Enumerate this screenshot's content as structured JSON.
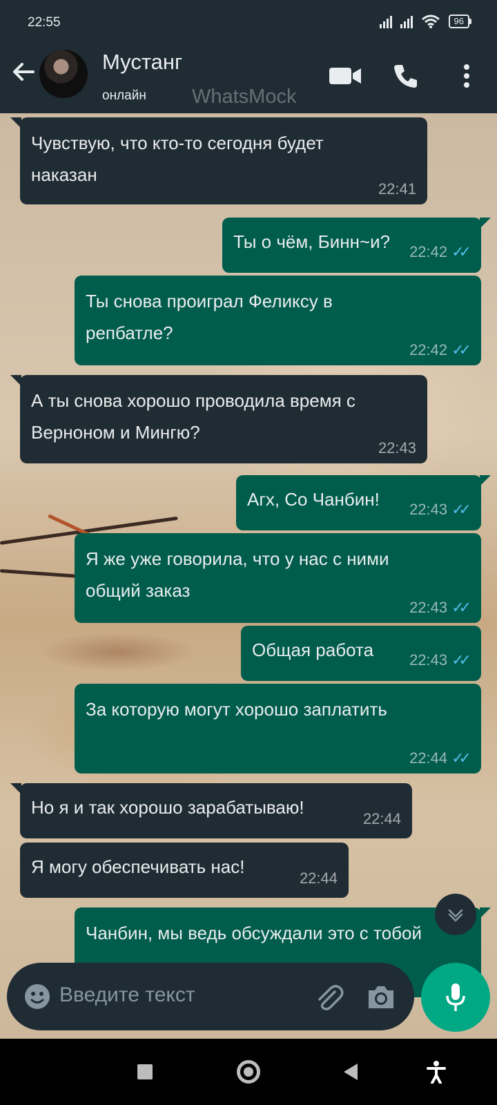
{
  "status_bar": {
    "time": "22:55",
    "battery": "96"
  },
  "header": {
    "contact_name": "Мустанг",
    "status": "онлайн",
    "watermark": "WhatsMock"
  },
  "messages": [
    {
      "direction": "in",
      "lines": [
        "Чувствую, что кто-то сегодня будет",
        "наказан"
      ],
      "time": "22:41"
    },
    {
      "direction": "out",
      "lines": [
        "Ты о чём, Бинн~и?"
      ],
      "time": "22:42",
      "read": true
    },
    {
      "direction": "out",
      "lines": [
        "Ты снова проиграл Феликсу в",
        "репбатле?"
      ],
      "time": "22:42",
      "read": true
    },
    {
      "direction": "in",
      "lines": [
        "А ты снова хорошо проводила время с",
        "Верноном и Мингю?"
      ],
      "time": "22:43"
    },
    {
      "direction": "out",
      "lines": [
        "Агх, Со Чанбин!"
      ],
      "time": "22:43",
      "read": true
    },
    {
      "direction": "out",
      "lines": [
        "Я же уже говорила, что у нас с ними",
        "общий заказ"
      ],
      "time": "22:43",
      "read": true
    },
    {
      "direction": "out",
      "lines": [
        "Общая работа"
      ],
      "time": "22:43",
      "read": true
    },
    {
      "direction": "out",
      "lines": [
        "За которую могут хорошо заплатить"
      ],
      "time": "22:44",
      "read": true
    },
    {
      "direction": "in",
      "lines": [
        "Но я и так хорошо зарабатываю!"
      ],
      "time": "22:44"
    },
    {
      "direction": "in",
      "lines": [
        "Я могу обеспечивать нас!"
      ],
      "time": "22:44"
    },
    {
      "direction": "out",
      "lines": [
        "Чанбин, мы ведь обсуждали это с тобой"
      ],
      "time": "",
      "read": true
    }
  ],
  "composer": {
    "placeholder": "Введите текст"
  },
  "colors": {
    "header_bg": "#1f2c34",
    "incoming_bubble": "#202c33",
    "outgoing_bubble": "#005c4b",
    "accent": "#00a884",
    "read_tick": "#53bdeb"
  },
  "icons": {
    "back": "arrow-left-icon",
    "video": "video-camera-icon",
    "call": "phone-icon",
    "menu": "more-vertical-icon",
    "emoji": "emoji-icon",
    "attach": "paperclip-icon",
    "camera": "camera-icon",
    "mic": "microphone-icon",
    "scroll_down": "chevron-down-icon",
    "nav_recent": "square-icon",
    "nav_home": "circle-icon",
    "nav_back": "triangle-back-icon",
    "accessibility": "accessibility-icon"
  }
}
